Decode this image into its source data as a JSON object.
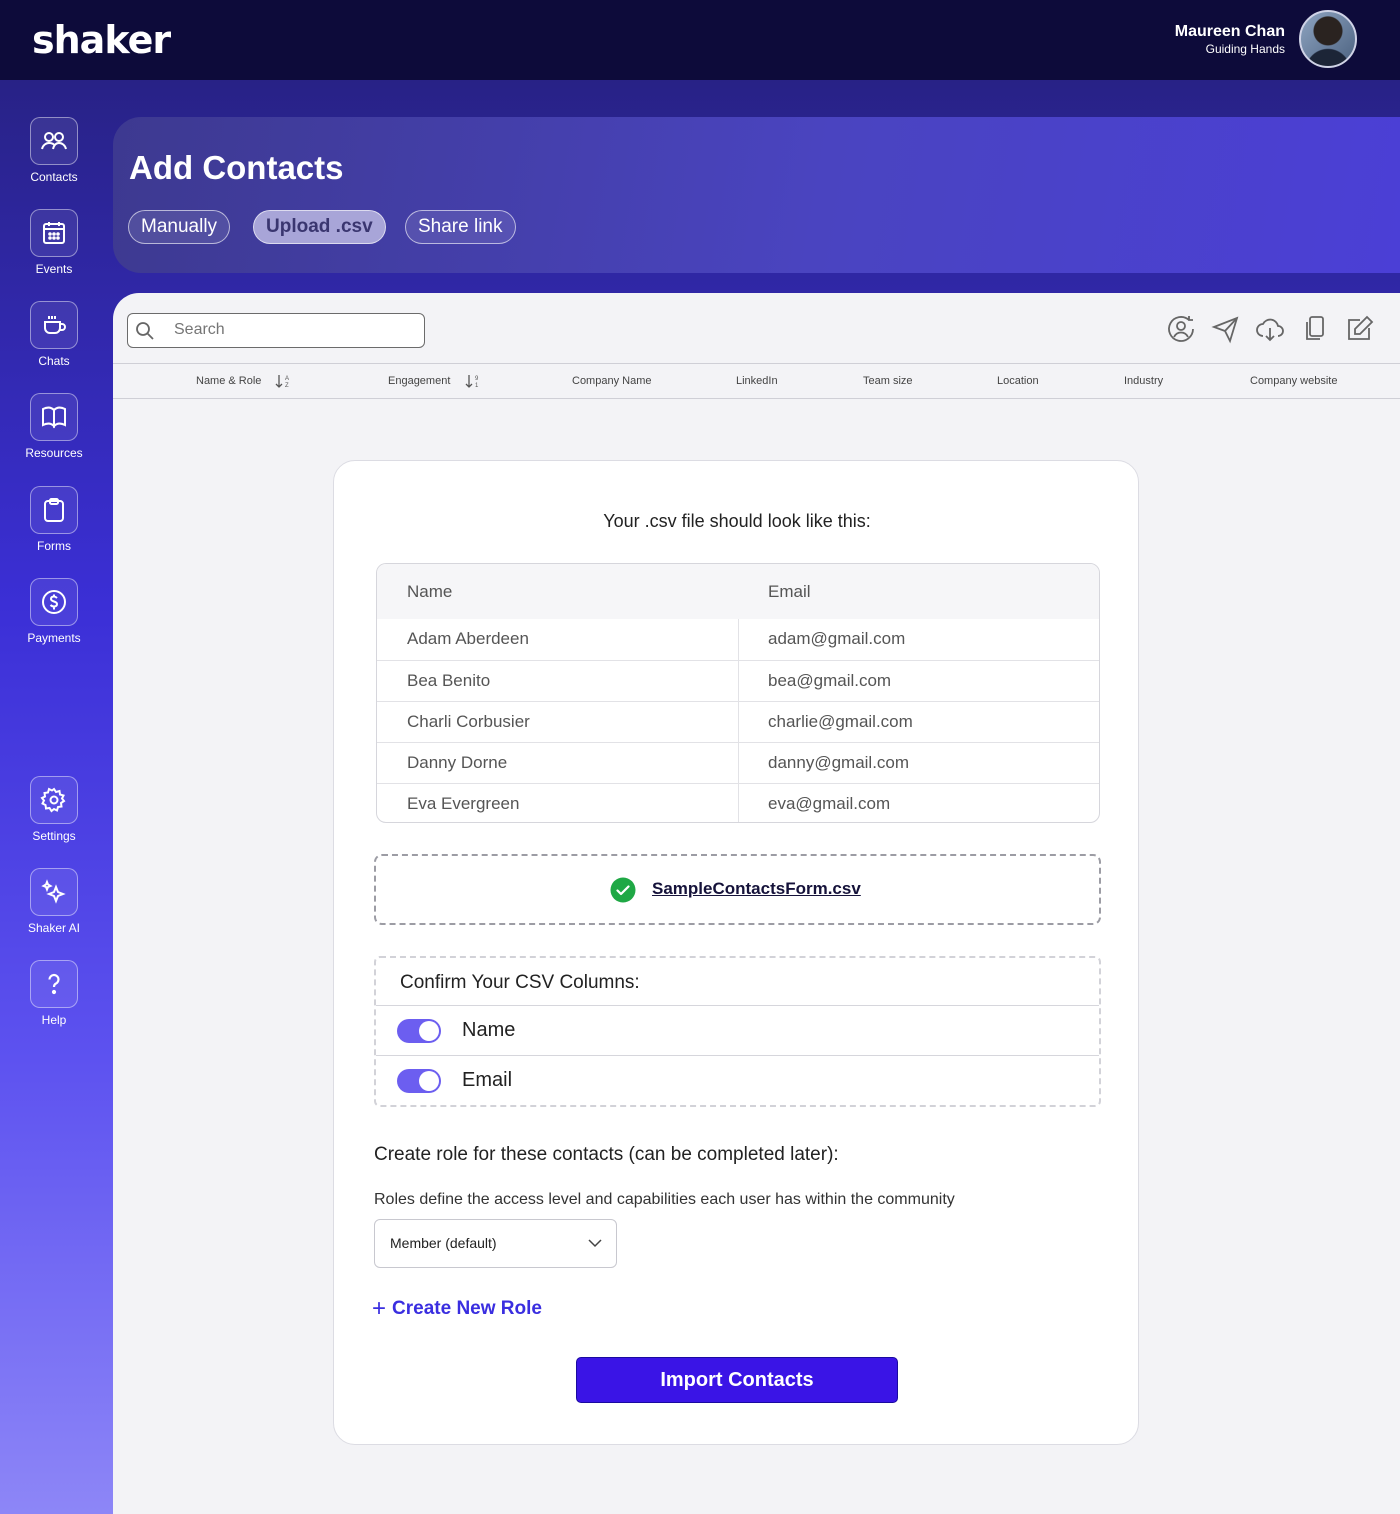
{
  "app": {
    "logo": "shaker"
  },
  "user": {
    "name": "Maureen Chan",
    "org": "Guiding Hands"
  },
  "sidebar": {
    "items": [
      {
        "label": "Contacts",
        "icon": "contacts-icon"
      },
      {
        "label": "Events",
        "icon": "calendar-icon"
      },
      {
        "label": "Chats",
        "icon": "coffee-cup-icon"
      },
      {
        "label": "Resources",
        "icon": "book-icon"
      },
      {
        "label": "Forms",
        "icon": "clipboard-icon"
      },
      {
        "label": "Payments",
        "icon": "dollar-circle-icon"
      },
      {
        "label": "Settings",
        "icon": "gear-icon"
      },
      {
        "label": "Shaker AI",
        "icon": "sparkle-icon"
      },
      {
        "label": "Help",
        "icon": "question-icon"
      }
    ]
  },
  "header": {
    "title": "Add Contacts",
    "tabs": [
      {
        "label": "Manually",
        "active": false
      },
      {
        "label": "Upload .csv",
        "active": true
      },
      {
        "label": "Share link",
        "active": false
      }
    ]
  },
  "search": {
    "placeholder": "Search"
  },
  "toolbar": [
    "user-sync-icon",
    "send-icon",
    "cloud-download-icon",
    "copy-icon",
    "edit-icon"
  ],
  "columns": [
    "Name & Role",
    "Engagement",
    "Company Name",
    "LinkedIn",
    "Team size",
    "Location",
    "Industry",
    "Company website"
  ],
  "card": {
    "title": "Your .csv file should look like this:",
    "sample_table": {
      "headers": [
        "Name",
        "Email"
      ],
      "rows": [
        [
          "Adam Aberdeen",
          "adam@gmail.com"
        ],
        [
          "Bea Benito",
          "bea@gmail.com"
        ],
        [
          "Charli Corbusier",
          "charlie@gmail.com"
        ],
        [
          "Danny Dorne",
          "danny@gmail.com"
        ],
        [
          "Eva Evergreen",
          "eva@gmail.com"
        ]
      ]
    },
    "uploaded_file": "SampleContactsForm.csv",
    "confirm": {
      "title": "Confirm Your CSV Columns:",
      "columns": [
        {
          "label": "Name",
          "enabled": true
        },
        {
          "label": "Email",
          "enabled": true
        }
      ]
    },
    "role": {
      "title": "Create role for these contacts (can be completed later):",
      "description": "Roles define the access level and capabilities each user has within the community",
      "selected": "Member (default)",
      "create_label": "Create New Role"
    },
    "import_label": "Import Contacts"
  },
  "colors": {
    "accent": "#3a14e6",
    "toggle": "#6c5ef0",
    "topbar": "#0d0b3a"
  }
}
